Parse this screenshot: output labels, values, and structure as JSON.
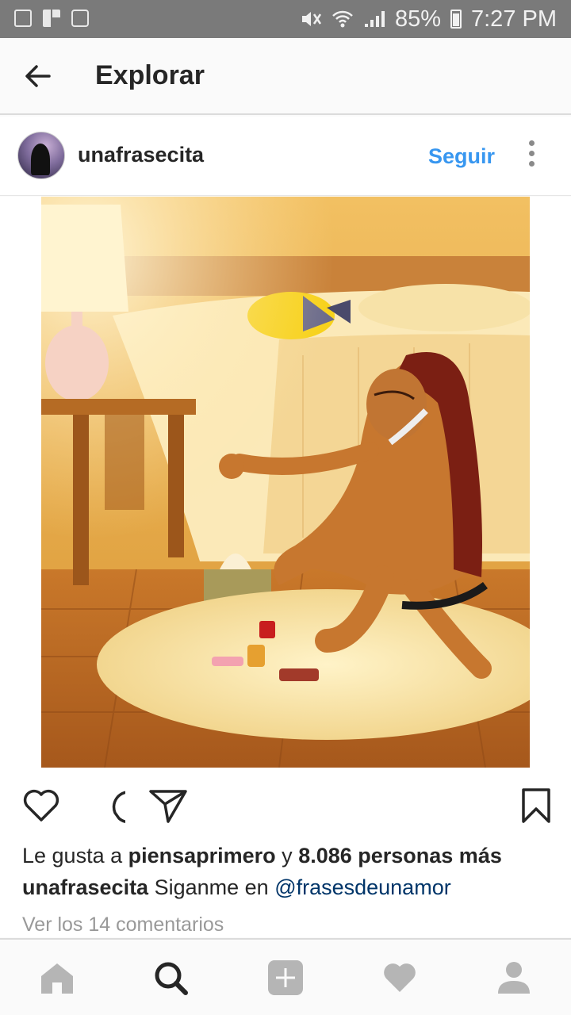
{
  "status_bar": {
    "battery_percent": "85%",
    "time": "7:27 PM",
    "icons": [
      "gallery-icon",
      "flipboard-icon",
      "recycle-icon",
      "mute-icon",
      "wifi-icon",
      "signal-icon",
      "battery-icon"
    ]
  },
  "header": {
    "title": "Explorar",
    "back_icon": "arrow-left-icon"
  },
  "post": {
    "username": "unafrasecita",
    "follow_label": "Seguir",
    "more_icon": "more-vertical-icon",
    "image_description_icon": "illustration-image",
    "actions": [
      "heart-icon",
      "comment-icon",
      "share-icon",
      "bookmark-icon"
    ],
    "likes": {
      "prefix": "Le gusta a ",
      "user": "piensaprimero",
      "joiner": " y ",
      "count_text": "8.086 personas más"
    },
    "caption": {
      "user": "unafrasecita",
      "text": " Siganme en ",
      "mention": "@frasesdeunamor"
    },
    "comments_link": "Ver los 14 comentarios"
  },
  "bottom_nav": {
    "items": [
      "home-icon",
      "search-icon",
      "add-icon",
      "activity-heart-icon",
      "profile-icon"
    ],
    "active": "search-icon"
  },
  "colors": {
    "accent": "#3897f0",
    "mention": "#003569",
    "status_bar": "#7a7a7a",
    "muted_text": "#999999"
  }
}
